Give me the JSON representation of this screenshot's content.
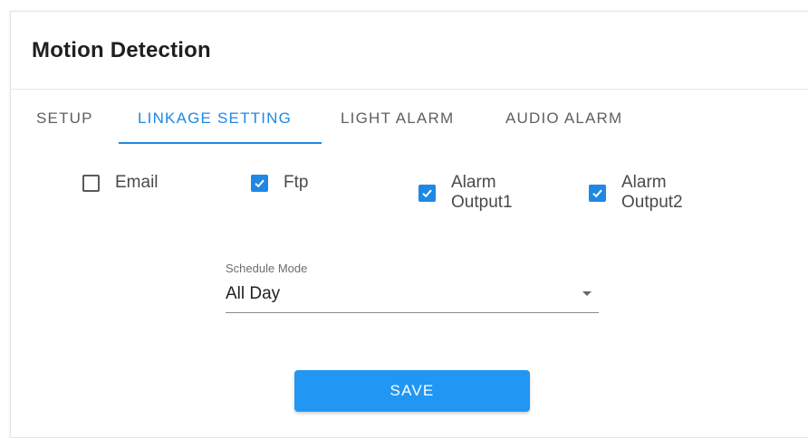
{
  "header": {
    "title": "Motion Detection"
  },
  "tabs": [
    {
      "label": "SETUP",
      "active": false
    },
    {
      "label": "LINKAGE SETTING",
      "active": true
    },
    {
      "label": "LIGHT ALARM",
      "active": false
    },
    {
      "label": "AUDIO ALARM",
      "active": false
    }
  ],
  "linkage": {
    "options": [
      {
        "label": "Email",
        "checked": false
      },
      {
        "label": "Ftp",
        "checked": true
      },
      {
        "label": "Alarm Output1",
        "checked": true
      },
      {
        "label": "Alarm Output2",
        "checked": true
      }
    ]
  },
  "schedule": {
    "label": "Schedule Mode",
    "value": "All Day"
  },
  "actions": {
    "save_label": "SAVE"
  },
  "colors": {
    "accent": "#1e88e5",
    "button": "#2196f3",
    "text": "#4a4a4a"
  }
}
